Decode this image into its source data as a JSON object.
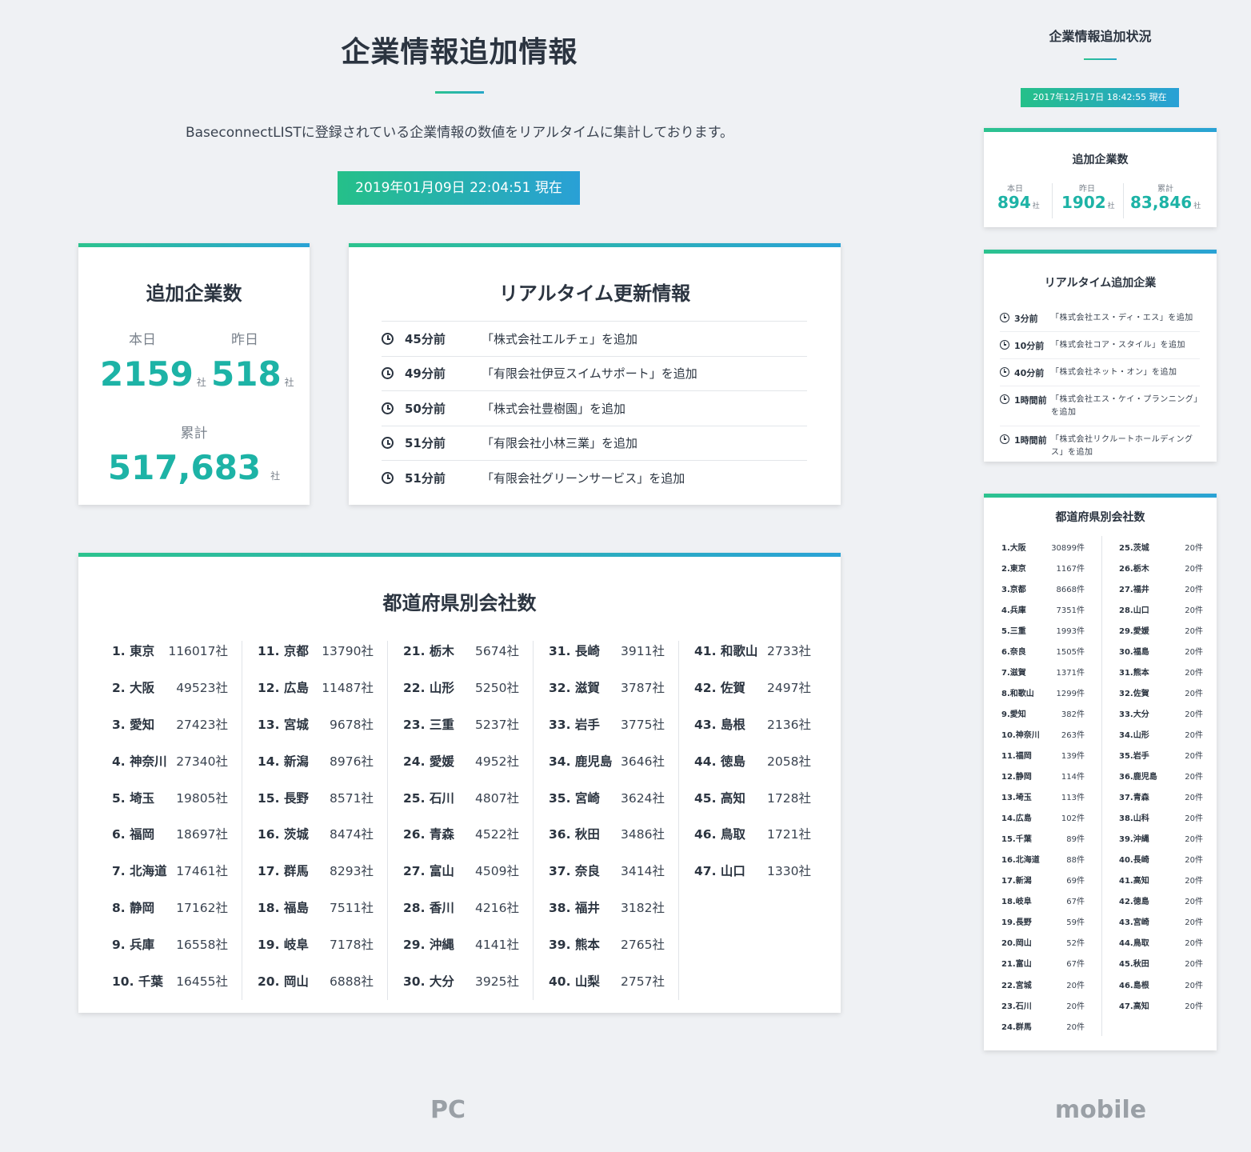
{
  "pc": {
    "title": "企業情報追加情報",
    "description": "BaseconnectLISTに登録されている企業情報の数値をリアルタイムに集計しております。",
    "timestamp": "2019年01月09日 22:04:51 現在",
    "counts": {
      "title": "追加企業数",
      "today_label": "本日",
      "today_value": "2159",
      "yesterday_label": "昨日",
      "yesterday_value": "518",
      "total_label": "累計",
      "total_value": "517,683",
      "unit": "社"
    },
    "realtime": {
      "title": "リアルタイム更新情報",
      "items": [
        {
          "time": "45分前",
          "text": "「株式会社エルチェ」を追加"
        },
        {
          "time": "49分前",
          "text": "「有限会社伊豆スイムサポート」を追加"
        },
        {
          "time": "50分前",
          "text": "「株式会社豊樹園」を追加"
        },
        {
          "time": "51分前",
          "text": "「有限会社小林三業」を追加"
        },
        {
          "time": "51分前",
          "text": "「有限会社グリーンサービス」を追加"
        }
      ]
    },
    "prefectures": {
      "title": "都道府県別会社数",
      "columns": [
        [
          {
            "name": "1. 東京",
            "value": "116017社"
          },
          {
            "name": "2. 大阪",
            "value": "49523社"
          },
          {
            "name": "3. 愛知",
            "value": "27423社"
          },
          {
            "name": "4. 神奈川",
            "value": "27340社"
          },
          {
            "name": "5. 埼玉",
            "value": "19805社"
          },
          {
            "name": "6. 福岡",
            "value": "18697社"
          },
          {
            "name": "7. 北海道",
            "value": "17461社"
          },
          {
            "name": "8. 静岡",
            "value": "17162社"
          },
          {
            "name": "9. 兵庫",
            "value": "16558社"
          },
          {
            "name": "10. 千葉",
            "value": "16455社"
          }
        ],
        [
          {
            "name": "11. 京都",
            "value": "13790社"
          },
          {
            "name": "12. 広島",
            "value": "11487社"
          },
          {
            "name": "13. 宮城",
            "value": "9678社"
          },
          {
            "name": "14. 新潟",
            "value": "8976社"
          },
          {
            "name": "15. 長野",
            "value": "8571社"
          },
          {
            "name": "16. 茨城",
            "value": "8474社"
          },
          {
            "name": "17. 群馬",
            "value": "8293社"
          },
          {
            "name": "18. 福島",
            "value": "7511社"
          },
          {
            "name": "19. 岐阜",
            "value": "7178社"
          },
          {
            "name": "20. 岡山",
            "value": "6888社"
          }
        ],
        [
          {
            "name": "21. 栃木",
            "value": "5674社"
          },
          {
            "name": "22. 山形",
            "value": "5250社"
          },
          {
            "name": "23. 三重",
            "value": "5237社"
          },
          {
            "name": "24. 愛媛",
            "value": "4952社"
          },
          {
            "name": "25. 石川",
            "value": "4807社"
          },
          {
            "name": "26. 青森",
            "value": "4522社"
          },
          {
            "name": "27. 富山",
            "value": "4509社"
          },
          {
            "name": "28. 香川",
            "value": "4216社"
          },
          {
            "name": "29. 沖縄",
            "value": "4141社"
          },
          {
            "name": "30. 大分",
            "value": "3925社"
          }
        ],
        [
          {
            "name": "31. 長崎",
            "value": "3911社"
          },
          {
            "name": "32. 滋賀",
            "value": "3787社"
          },
          {
            "name": "33. 岩手",
            "value": "3775社"
          },
          {
            "name": "34. 鹿児島",
            "value": "3646社"
          },
          {
            "name": "35. 宮崎",
            "value": "3624社"
          },
          {
            "name": "36. 秋田",
            "value": "3486社"
          },
          {
            "name": "37. 奈良",
            "value": "3414社"
          },
          {
            "name": "38. 福井",
            "value": "3182社"
          },
          {
            "name": "39. 熊本",
            "value": "2765社"
          },
          {
            "name": "40. 山梨",
            "value": "2757社"
          }
        ],
        [
          {
            "name": "41. 和歌山",
            "value": "2733社"
          },
          {
            "name": "42. 佐賀",
            "value": "2497社"
          },
          {
            "name": "43. 島根",
            "value": "2136社"
          },
          {
            "name": "44. 徳島",
            "value": "2058社"
          },
          {
            "name": "45. 高知",
            "value": "1728社"
          },
          {
            "name": "46. 鳥取",
            "value": "1721社"
          },
          {
            "name": "47. 山口",
            "value": "1330社"
          }
        ]
      ]
    },
    "label": "PC"
  },
  "mobile": {
    "title": "企業情報追加状況",
    "timestamp": "2017年12月17日 18:42:55 現在",
    "counts": {
      "title": "追加企業数",
      "today_label": "本日",
      "today_value": "894",
      "yesterday_label": "昨日",
      "yesterday_value": "1902",
      "total_label": "累計",
      "total_value": "83,846",
      "unit": "社"
    },
    "realtime": {
      "title": "リアルタイム追加企業",
      "items": [
        {
          "time": "3分前",
          "text": "「株式会社エス・ディ・エス」を追加"
        },
        {
          "time": "10分前",
          "text": "「株式会社コア・スタイル」を追加"
        },
        {
          "time": "40分前",
          "text": "「株式会社ネット・オン」を追加"
        },
        {
          "time": "1時間前",
          "text": "「株式会社エス・ケイ・プランニング」を追加"
        },
        {
          "time": "1時間前",
          "text": "「株式会社リクルートホールディングス」を追加"
        }
      ]
    },
    "prefectures": {
      "title": "都道府県別会社数",
      "columns": [
        [
          {
            "name": "1.大阪",
            "value": "30899件"
          },
          {
            "name": "2.東京",
            "value": "1167件"
          },
          {
            "name": "3.京都",
            "value": "8668件"
          },
          {
            "name": "4.兵庫",
            "value": "7351件"
          },
          {
            "name": "5.三重",
            "value": "1993件"
          },
          {
            "name": "6.奈良",
            "value": "1505件"
          },
          {
            "name": "7.滋賀",
            "value": "1371件"
          },
          {
            "name": "8.和歌山",
            "value": "1299件"
          },
          {
            "name": "9.愛知",
            "value": "382件"
          },
          {
            "name": "10.神奈川",
            "value": "263件"
          },
          {
            "name": "11.福岡",
            "value": "139件"
          },
          {
            "name": "12.静岡",
            "value": "114件"
          },
          {
            "name": "13.埼玉",
            "value": "113件"
          },
          {
            "name": "14.広島",
            "value": "102件"
          },
          {
            "name": "15.千葉",
            "value": "89件"
          },
          {
            "name": "16.北海道",
            "value": "88件"
          },
          {
            "name": "17.新潟",
            "value": "69件"
          },
          {
            "name": "18.岐阜",
            "value": "67件"
          },
          {
            "name": "19.長野",
            "value": "59件"
          },
          {
            "name": "20.岡山",
            "value": "52件"
          },
          {
            "name": "21.富山",
            "value": "67件"
          },
          {
            "name": "22.宮城",
            "value": "20件"
          },
          {
            "name": "23.石川",
            "value": "20件"
          },
          {
            "name": "24.群馬",
            "value": "20件"
          }
        ],
        [
          {
            "name": "25.茨城",
            "value": "20件"
          },
          {
            "name": "26.栃木",
            "value": "20件"
          },
          {
            "name": "27.福井",
            "value": "20件"
          },
          {
            "name": "28.山口",
            "value": "20件"
          },
          {
            "name": "29.愛媛",
            "value": "20件"
          },
          {
            "name": "30.福島",
            "value": "20件"
          },
          {
            "name": "31.熊本",
            "value": "20件"
          },
          {
            "name": "32.佐賀",
            "value": "20件"
          },
          {
            "name": "33.大分",
            "value": "20件"
          },
          {
            "name": "34.山形",
            "value": "20件"
          },
          {
            "name": "35.岩手",
            "value": "20件"
          },
          {
            "name": "36.鹿児島",
            "value": "20件"
          },
          {
            "name": "37.青森",
            "value": "20件"
          },
          {
            "name": "38.山科",
            "value": "20件"
          },
          {
            "name": "39.沖縄",
            "value": "20件"
          },
          {
            "name": "40.長崎",
            "value": "20件"
          },
          {
            "name": "41.高知",
            "value": "20件"
          },
          {
            "name": "42.徳島",
            "value": "20件"
          },
          {
            "name": "43.宮崎",
            "value": "20件"
          },
          {
            "name": "44.鳥取",
            "value": "20件"
          },
          {
            "name": "45.秋田",
            "value": "20件"
          },
          {
            "name": "46.島根",
            "value": "20件"
          },
          {
            "name": "47.高知",
            "value": "20件"
          }
        ]
      ]
    },
    "label": "mobile"
  },
  "colors": {
    "accent_green": "#2cc38e",
    "accent_blue": "#2aa2d6",
    "number_teal": "#1db3a6",
    "background": "#eff1f4"
  }
}
